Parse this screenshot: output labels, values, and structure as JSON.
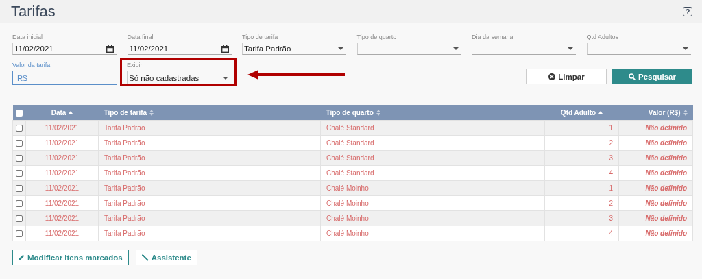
{
  "page": {
    "title": "Tarifas",
    "help": "?"
  },
  "filters": [
    {
      "label": "Data inicial",
      "value": "11/02/2021",
      "kind": "date"
    },
    {
      "label": "Data final",
      "value": "11/02/2021",
      "kind": "date"
    },
    {
      "label": "Tipo de tarifa",
      "value": "Tarifa Padrão",
      "kind": "select"
    },
    {
      "label": "Tipo de quarto",
      "kind": "select"
    },
    {
      "label": "Dia da semana",
      "kind": "select"
    },
    {
      "label": "Qtd Adultos",
      "kind": "select"
    }
  ],
  "price_field": {
    "label": "Valor da tarifa",
    "value": "R$"
  },
  "show_field": {
    "label": "Exibir",
    "value": "Só não cadastradas"
  },
  "buttons": [
    {
      "label": "Limpar",
      "kind": "clear"
    },
    {
      "label": "Pesquisar",
      "kind": "search"
    }
  ],
  "table": {
    "select_all": {
      "checked": false
    },
    "columns": [
      {
        "label": "Data",
        "sorted": true
      },
      {
        "label": "Tipo de tarifa",
        "sorted": false
      },
      {
        "label": "Tipo de quarto",
        "sorted": false
      },
      {
        "label": "Qtd Adulto",
        "sorted": true
      },
      {
        "label": "Valor (R$)",
        "sorted": false
      }
    ],
    "rows": [
      {
        "checked": false,
        "cells": [
          "11/02/2021",
          "Tarifa Padrão",
          "Chalé Standard",
          "1",
          "Não definido"
        ]
      },
      {
        "checked": false,
        "cells": [
          "11/02/2021",
          "Tarifa Padrão",
          "Chalé Standard",
          "2",
          "Não definido"
        ]
      },
      {
        "checked": false,
        "cells": [
          "11/02/2021",
          "Tarifa Padrão",
          "Chalé Standard",
          "3",
          "Não definido"
        ]
      },
      {
        "checked": false,
        "cells": [
          "11/02/2021",
          "Tarifa Padrão",
          "Chalé Standard",
          "4",
          "Não definido"
        ]
      },
      {
        "checked": false,
        "cells": [
          "11/02/2021",
          "Tarifa Padrão",
          "Chalé Moinho",
          "1",
          "Não definido"
        ]
      },
      {
        "checked": false,
        "cells": [
          "11/02/2021",
          "Tarifa Padrão",
          "Chalé Moinho",
          "2",
          "Não definido"
        ]
      },
      {
        "checked": false,
        "cells": [
          "11/02/2021",
          "Tarifa Padrão",
          "Chalé Moinho",
          "3",
          "Não definido"
        ]
      },
      {
        "checked": false,
        "cells": [
          "11/02/2021",
          "Tarifa Padrão",
          "Chalé Moinho",
          "4",
          "Não definido"
        ]
      }
    ]
  },
  "footer_buttons": [
    {
      "label": "Modificar itens marcados",
      "kind": "edit"
    },
    {
      "label": "Assistente",
      "kind": "wizard"
    }
  ]
}
